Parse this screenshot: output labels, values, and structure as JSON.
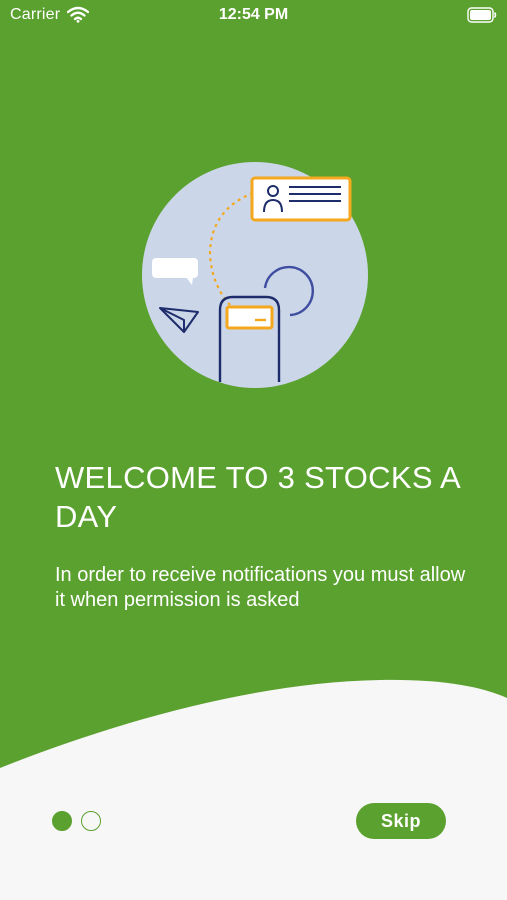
{
  "status_bar": {
    "carrier": "Carrier",
    "time": "12:54 PM"
  },
  "onboarding": {
    "title": "WELCOME TO 3 STOCKS A DAY",
    "body": "In order to receive notifications you must allow it when permission is asked",
    "illustration": "notification-permission-illustration"
  },
  "pager": {
    "page_count": 2,
    "current_page": 1
  },
  "controls": {
    "skip_label": "Skip"
  },
  "colors": {
    "primary_green": "#5ba12f",
    "background_light": "#f7f7f7",
    "illustration_circle": "#cbd6e8",
    "illustration_navy": "#1d2d6b",
    "illustration_orange": "#f4a81d"
  }
}
